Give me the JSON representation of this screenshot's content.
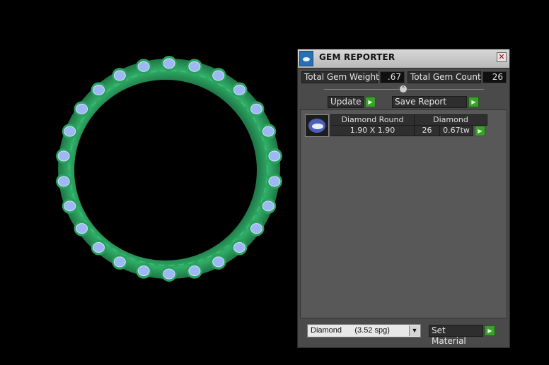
{
  "window": {
    "title": "GEM REPORTER",
    "close_glyph": "✕"
  },
  "summary": {
    "total_weight_label": "Total Gem Weight",
    "total_weight_value": ".67",
    "total_count_label": "Total Gem Count",
    "total_count_value": "26"
  },
  "slider": {
    "glyph": "⌃"
  },
  "actions": {
    "update_label": "Update",
    "save_report_label": "Save Report",
    "arrow_glyph": "▶"
  },
  "gem_rows": [
    {
      "shape": "Diamond Round",
      "material": "Diamond",
      "size": "1.90 X 1.90",
      "count": "26",
      "weight": "0.67tw"
    }
  ],
  "footer": {
    "material_select_value": "Diamond      (3.52 spg)",
    "select_arrow_glyph": "▼",
    "set_material_label": "Set Material"
  },
  "colors": {
    "ring_green": "#2a9a5c",
    "gem_blue": "#9db8f2",
    "panel_bg": "#4a4a4a",
    "accent_green": "#3aa12a"
  }
}
